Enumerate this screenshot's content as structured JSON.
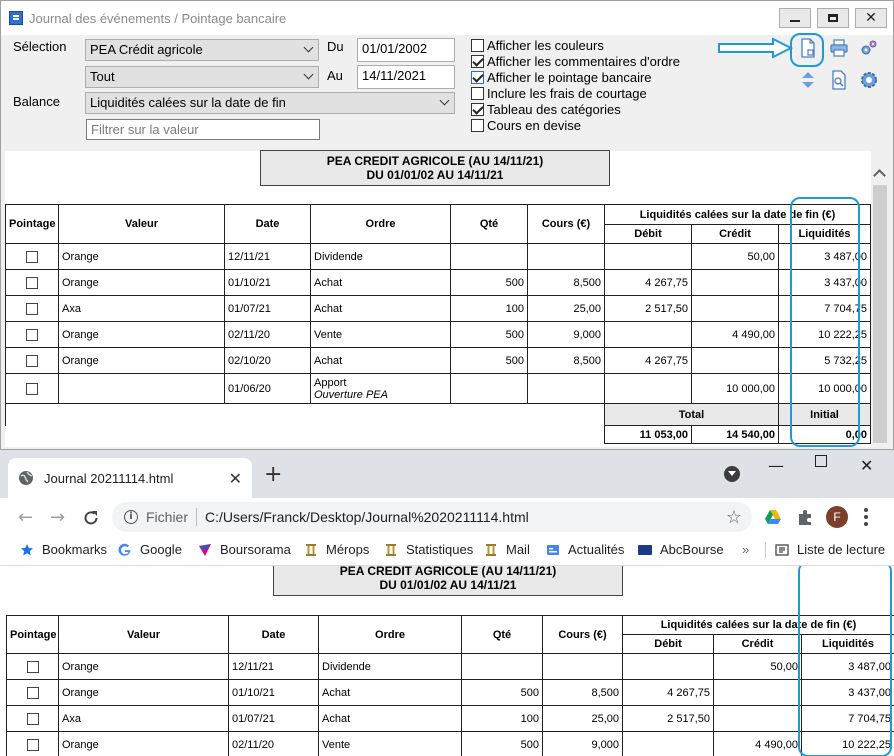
{
  "app": {
    "title": "Journal des événements / Pointage bancaire",
    "labels": {
      "selection": "Sélection",
      "balance": "Balance",
      "du": "Du",
      "au": "Au"
    },
    "selection_value": "PEA Crédit agricole",
    "type_value": "Tout",
    "balance_value": "Liquidités calées sur la date de fin",
    "filter_placeholder": "Filtrer sur la valeur",
    "date_from": "01/01/2002",
    "date_to": "14/11/2021",
    "options": [
      {
        "label": "Afficher les couleurs",
        "checked": false
      },
      {
        "label": "Afficher les commentaires d'ordre",
        "checked": true
      },
      {
        "label": "Afficher le pointage bancaire",
        "checked": true
      },
      {
        "label": "Inclure les frais de courtage",
        "checked": false
      },
      {
        "label": "Tableau des catégories",
        "checked": true
      },
      {
        "label": "Cours en devise",
        "checked": false
      }
    ],
    "toolbar_icons": [
      "export-html-icon",
      "print-icon",
      "settings-gears-icon",
      "sort-icon",
      "preview-icon",
      "settings-gear-icon"
    ]
  },
  "report": {
    "title_line1": "PEA CREDIT AGRICOLE (AU 14/11/21)",
    "title_line2": "DU 01/01/02 AU 14/11/21",
    "headers": {
      "pointage": "Pointage",
      "valeur": "Valeur",
      "date": "Date",
      "ordre": "Ordre",
      "qte": "Qté",
      "cours": "Cours (€)",
      "group": "Liquidités calées sur la date de fin (€)",
      "debit": "Débit",
      "credit": "Crédit",
      "liquidites": "Liquidités"
    },
    "rows": [
      {
        "valeur": "Orange",
        "date": "12/11/21",
        "ordre": "Dividende",
        "comment": "",
        "qte": "",
        "cours": "",
        "debit": "",
        "credit": "50,00",
        "liq": "3 487,00"
      },
      {
        "valeur": "Orange",
        "date": "01/10/21",
        "ordre": "Achat",
        "comment": "",
        "qte": "500",
        "cours": "8,500",
        "debit": "4 267,75",
        "credit": "",
        "liq": "3 437,00"
      },
      {
        "valeur": "Axa",
        "date": "01/07/21",
        "ordre": "Achat",
        "comment": "",
        "qte": "100",
        "cours": "25,00",
        "debit": "2 517,50",
        "credit": "",
        "liq": "7 704,75"
      },
      {
        "valeur": "Orange",
        "date": "02/11/20",
        "ordre": "Vente",
        "comment": "",
        "qte": "500",
        "cours": "9,000",
        "debit": "",
        "credit": "4 490,00",
        "liq": "10 222,25"
      },
      {
        "valeur": "Orange",
        "date": "02/10/20",
        "ordre": "Achat",
        "comment": "",
        "qte": "500",
        "cours": "8,500",
        "debit": "4 267,75",
        "credit": "",
        "liq": "5 732,25"
      },
      {
        "valeur": "",
        "date": "01/06/20",
        "ordre": "Apport",
        "comment": "Ouverture PEA",
        "qte": "",
        "cours": "",
        "debit": "",
        "credit": "10 000,00",
        "liq": "10 000,00"
      }
    ],
    "total_label": "Total",
    "initial_label": "Initial",
    "total_debit": "11 053,00",
    "total_credit": "14 540,00",
    "initial_value": "0,00"
  },
  "browser": {
    "tab_title": "Journal 20211114.html",
    "scheme": "Fichier",
    "url": "C:/Users/Franck/Desktop/Journal%2020211114.html",
    "profile_initial": "F",
    "bookmarks": [
      "Bookmarks",
      "Google",
      "Boursorama",
      "Mérops",
      "Statistiques",
      "Mail",
      "Actualités",
      "AbcBourse"
    ],
    "more": "»",
    "reading_list": "Liste de lecture"
  },
  "colors": {
    "highlight": "#1e9ad6",
    "header_grey": "#e8e8e8",
    "chrome_tabstrip": "#dee1e6"
  }
}
